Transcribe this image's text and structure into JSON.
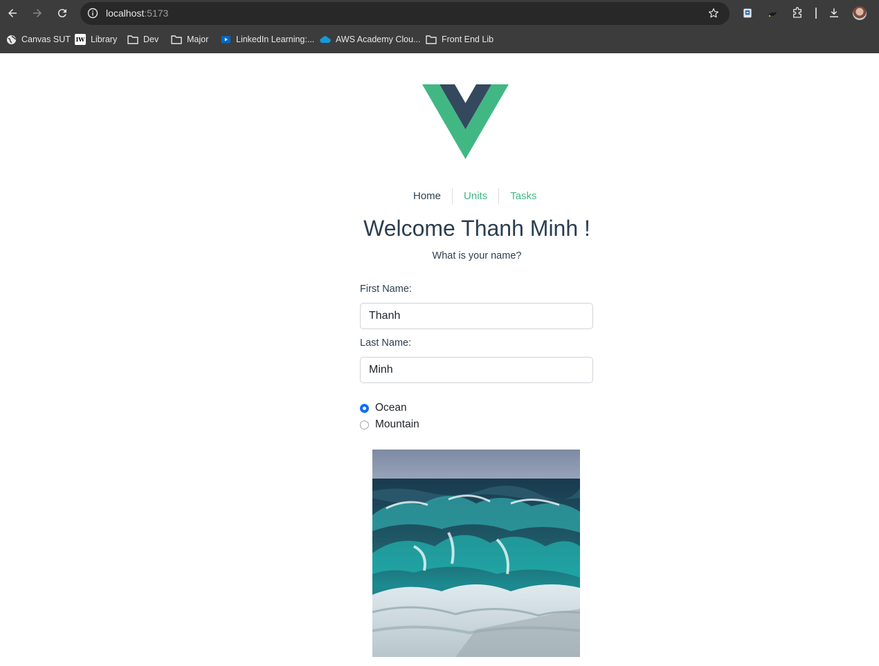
{
  "browser": {
    "url_host": "localhost",
    "url_port": ":5173",
    "bookmarks": [
      {
        "label": "Canvas SUT",
        "icon": "globe-icon"
      },
      {
        "label": "Library",
        "icon": "iw-logo-icon",
        "icon_text": "IW"
      },
      {
        "label": "Dev",
        "icon": "folder-icon"
      },
      {
        "label": "Major",
        "icon": "folder-icon"
      },
      {
        "label": "LinkedIn Learning:...",
        "icon": "linkedin-learning-icon"
      },
      {
        "label": "AWS Academy Clou...",
        "icon": "cloud-icon"
      },
      {
        "label": "Front End Lib",
        "icon": "folder-icon"
      }
    ]
  },
  "nav": {
    "items": [
      {
        "label": "Home",
        "color": "#2c3e50"
      },
      {
        "label": "Units",
        "color": "#42b883"
      },
      {
        "label": "Tasks",
        "color": "#42b883"
      }
    ]
  },
  "page": {
    "title": "Welcome Thanh Minh !",
    "subtitle": "What is your name?"
  },
  "form": {
    "first_name_label": "First Name:",
    "first_name_value": "Thanh",
    "last_name_label": "Last Name:",
    "last_name_value": "Minh",
    "options": [
      {
        "label": "Ocean",
        "selected": true
      },
      {
        "label": "Mountain",
        "selected": false
      }
    ]
  },
  "colors": {
    "vue_green": "#41b883",
    "vue_dark": "#34495e",
    "text": "#2c3e50",
    "radio_selected": "#0d6efd"
  }
}
